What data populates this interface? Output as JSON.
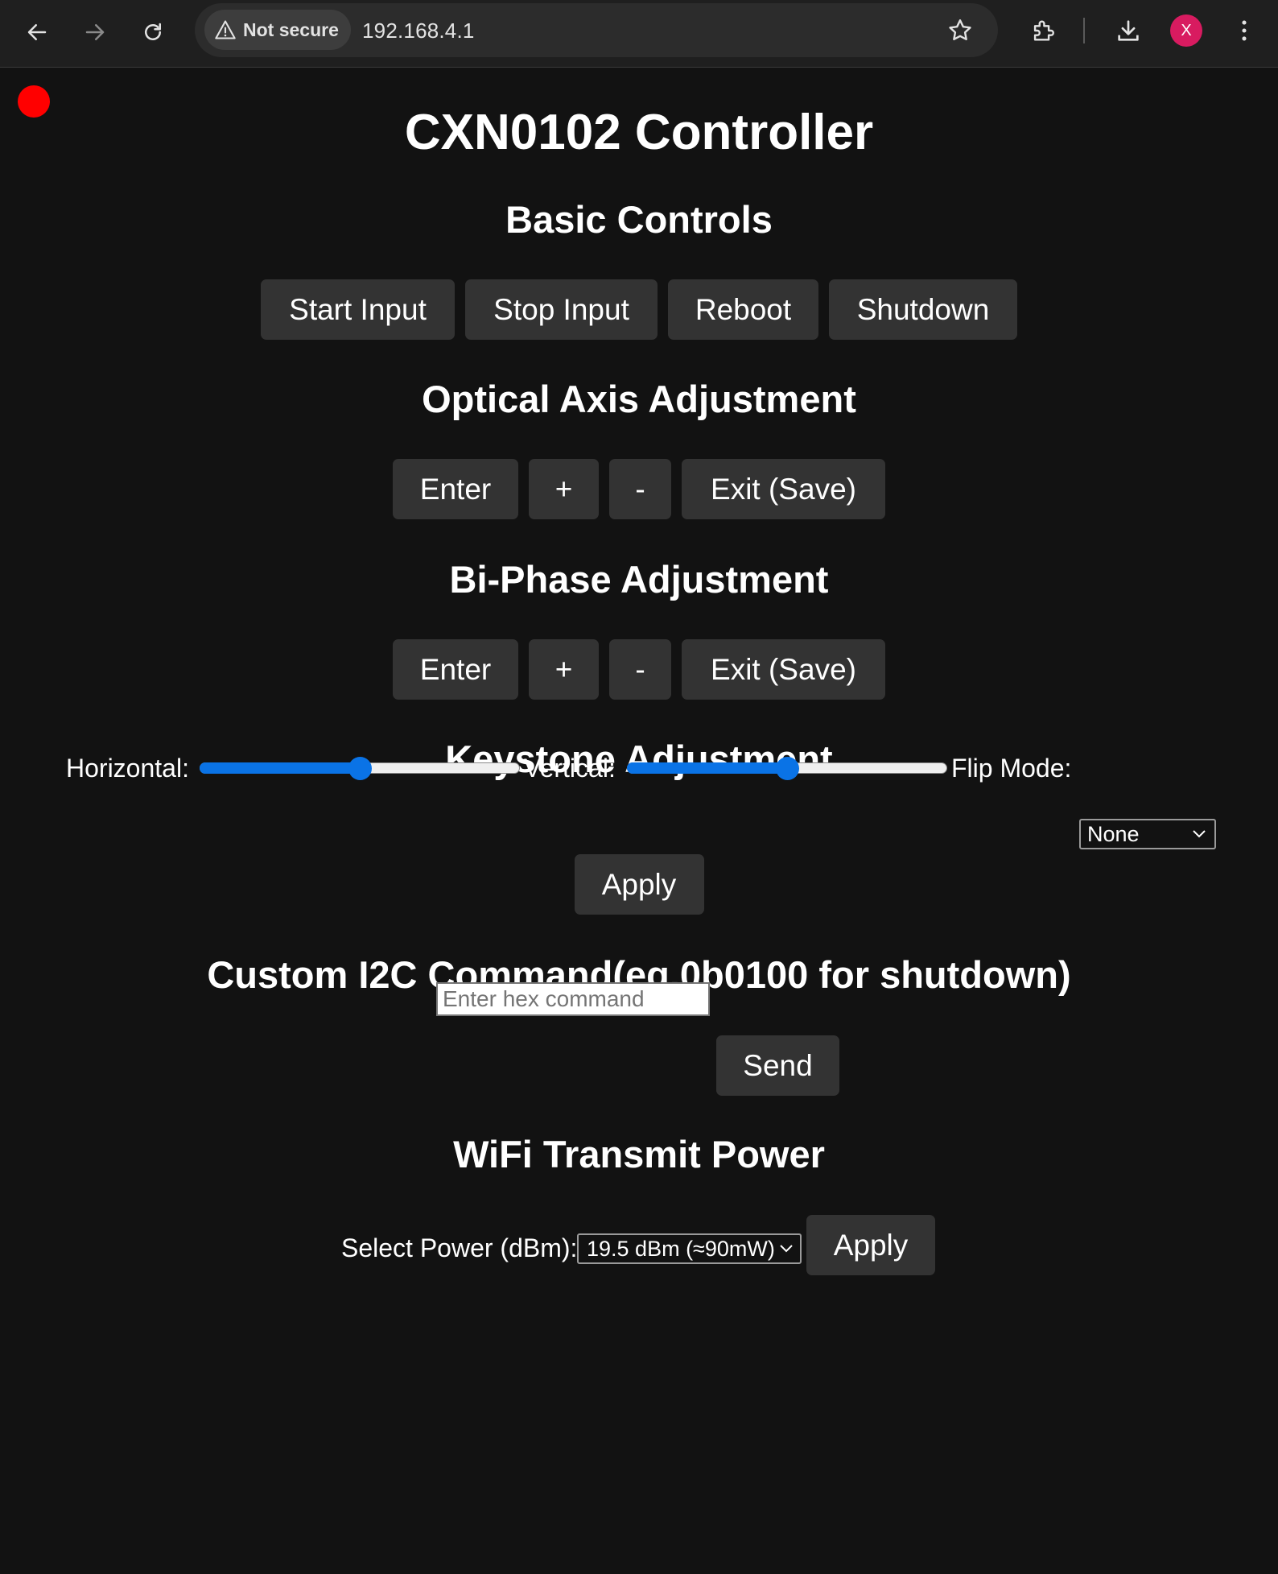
{
  "browser": {
    "security_label": "Not secure",
    "url": "192.168.4.1",
    "profile_initial": "X"
  },
  "page": {
    "status_color": "#ff0000",
    "title": "CXN0102 Controller",
    "basic": {
      "heading": "Basic Controls",
      "buttons": [
        "Start Input",
        "Stop Input",
        "Reboot",
        "Shutdown"
      ]
    },
    "optical": {
      "heading": "Optical Axis Adjustment",
      "buttons": [
        "Enter",
        "+",
        "-",
        "Exit (Save)"
      ]
    },
    "biphase": {
      "heading": "Bi-Phase Adjustment",
      "buttons": [
        "Enter",
        "+",
        "-",
        "Exit (Save)"
      ]
    },
    "keystone": {
      "heading": "Keystone Adjustment",
      "horizontal_label": "Horizontal:",
      "horizontal_value": 0.5,
      "vertical_label": "Vertical:",
      "vertical_value": 0.5,
      "flip_label": "Flip Mode:",
      "flip_value": "None",
      "apply_label": "Apply"
    },
    "custom": {
      "heading": "Custom I2C Command(eg.0b0100 for shutdown)",
      "input_placeholder": "Enter hex command",
      "send_label": "Send"
    },
    "wifi": {
      "heading": "WiFi Transmit Power",
      "select_label": "Select Power (dBm):",
      "select_value": "19.5 dBm (≈90mW)",
      "apply_label": "Apply"
    }
  }
}
